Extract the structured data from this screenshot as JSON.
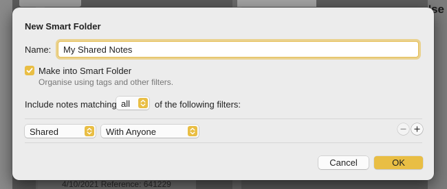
{
  "dialog": {
    "title": "New Smart Folder",
    "name_label": "Name:",
    "name_value": "My Shared Notes",
    "smart_folder_checkbox": {
      "checked": true,
      "label": "Make into Smart Folder",
      "description": "Organise using tags and other filters."
    },
    "match": {
      "prefix": "Include notes matching",
      "selected": "all",
      "suffix": "of the following filters:"
    },
    "filter_rule": {
      "field": "Shared",
      "value": "With Anyone"
    },
    "buttons": {
      "remove_icon": "minus-icon",
      "add_icon": "plus-icon",
      "cancel": "Cancel",
      "ok": "OK"
    }
  },
  "background": {
    "bottom_text": "4/10/2021   Reference: 641229",
    "right_text": "'se"
  },
  "colors": {
    "accent": "#e9be44",
    "sheet": "#ececec"
  }
}
